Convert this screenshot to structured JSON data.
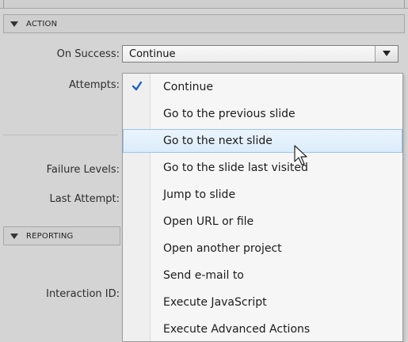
{
  "sections": {
    "action": {
      "title": "ACTION"
    },
    "reporting": {
      "title": "REPORTING"
    }
  },
  "fields": {
    "on_success_label": "On Success:",
    "attempts_label": "Attempts:",
    "failure_levels_label": "Failure Levels:",
    "last_attempt_label": "Last Attempt:",
    "interaction_id_label": "Interaction ID:"
  },
  "on_success_select": {
    "value": "Continue",
    "options": [
      "Continue",
      "Go to the previous slide",
      "Go to the next slide",
      "Go to the slide last visited",
      "Jump to slide",
      "Open URL or file",
      "Open another project",
      "Send e-mail to",
      "Execute JavaScript",
      "Execute Advanced Actions"
    ],
    "selected_option": "Continue",
    "hovered_option": "Go to the next slide"
  },
  "icons": {
    "dropdown_arrow": "chevron-down-icon",
    "checkmark": "checkmark-icon",
    "cursor": "mouse-pointer-icon",
    "section_toggle": "triangle-down-icon"
  },
  "colors": {
    "panel_bg": "#d4d4d4",
    "menu_bg": "#f6f6f6",
    "hover_bg": "#dcecfb",
    "hover_border": "#9cc3ea",
    "check_color": "#1f5fbf"
  }
}
